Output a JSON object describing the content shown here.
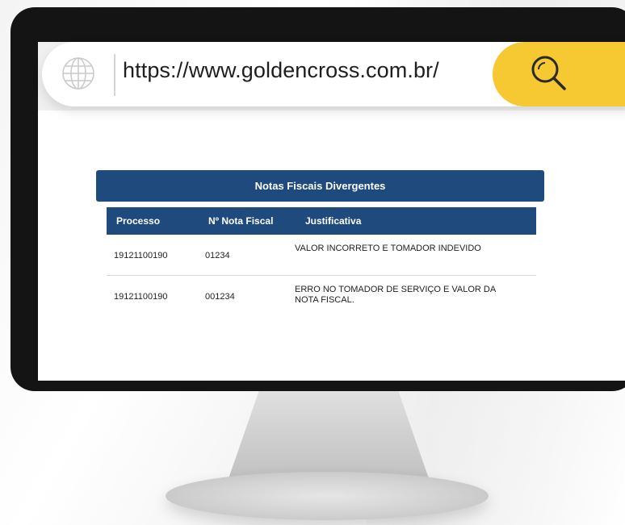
{
  "browser": {
    "url": "https://www.goldencross.com.br/",
    "globe_icon": "globe-icon",
    "search_icon": "search-icon",
    "accent_color": "#f6c933"
  },
  "panel": {
    "title": "Notas Fiscais Divergentes",
    "header_color": "#1f4a7e"
  },
  "table": {
    "columns": [
      "Processo",
      "Nº Nota Fiscal",
      "Justificativa"
    ],
    "rows": [
      [
        "19121100190",
        "01234",
        "VALOR INCORRETO E TOMADOR INDEVIDO"
      ],
      [
        "19121100190",
        "001234",
        "ERRO NO TOMADOR DE SERVIÇO E VALOR DA NOTA FISCAL."
      ]
    ]
  }
}
